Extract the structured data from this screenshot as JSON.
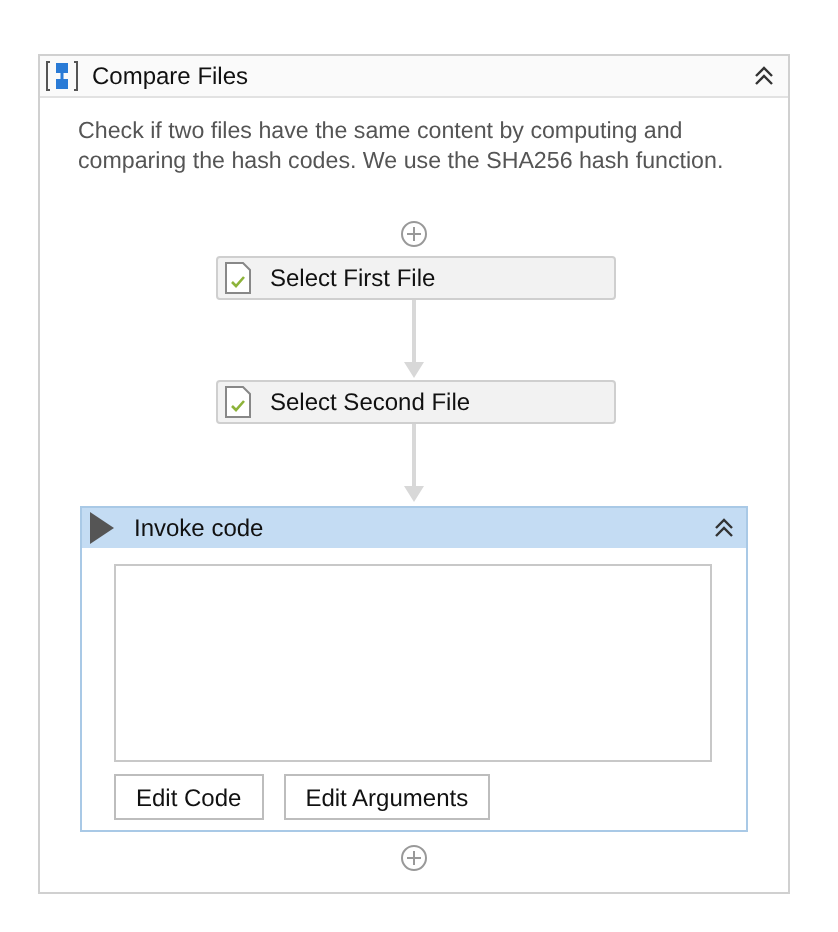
{
  "sequence": {
    "title": "Compare Files",
    "description": "Check if two files have the same content by computing and comparing the hash codes. We use the SHA256 hash function.",
    "activities": [
      {
        "kind": "step",
        "title": "Select First File"
      },
      {
        "kind": "step",
        "title": "Select Second File"
      },
      {
        "kind": "invoke",
        "title": "Invoke code",
        "buttons": [
          "Edit Code",
          "Edit Arguments"
        ]
      }
    ]
  }
}
